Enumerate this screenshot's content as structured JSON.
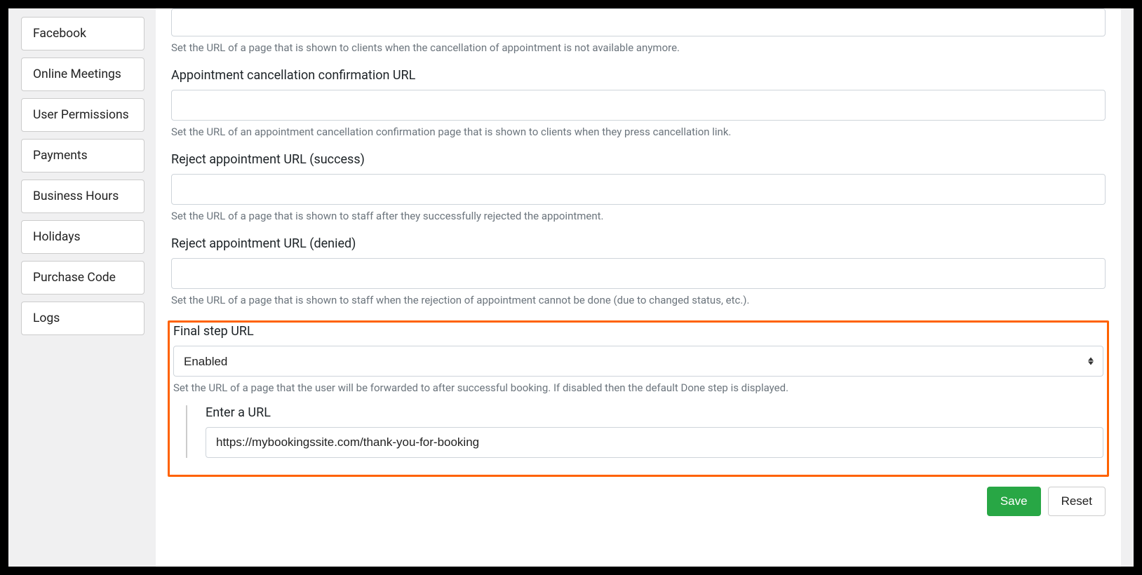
{
  "sidebar": {
    "items": [
      {
        "label": "Facebook"
      },
      {
        "label": "Online Meetings"
      },
      {
        "label": "User Permissions"
      },
      {
        "label": "Payments"
      },
      {
        "label": "Business Hours"
      },
      {
        "label": "Holidays"
      },
      {
        "label": "Purchase Code"
      },
      {
        "label": "Logs"
      }
    ]
  },
  "form": {
    "cancel_na": {
      "help": "Set the URL of a page that is shown to clients when the cancellation of appointment is not available anymore.",
      "value": ""
    },
    "cancel_confirm": {
      "label": "Appointment cancellation confirmation URL",
      "help": "Set the URL of an appointment cancellation confirmation page that is shown to clients when they press cancellation link.",
      "value": ""
    },
    "reject_success": {
      "label": "Reject appointment URL (success)",
      "help": "Set the URL of a page that is shown to staff after they successfully rejected the appointment.",
      "value": ""
    },
    "reject_denied": {
      "label": "Reject appointment URL (denied)",
      "help": "Set the URL of a page that is shown to staff when the rejection of appointment cannot be done (due to changed status, etc.).",
      "value": ""
    },
    "final_step": {
      "label": "Final step URL",
      "select_value": "Enabled",
      "help": "Set the URL of a page that the user will be forwarded to after successful booking. If disabled then the default Done step is displayed.",
      "url_label": "Enter a URL",
      "url_value": "https://mybookingssite.com/thank-you-for-booking"
    }
  },
  "buttons": {
    "save": "Save",
    "reset": "Reset"
  }
}
